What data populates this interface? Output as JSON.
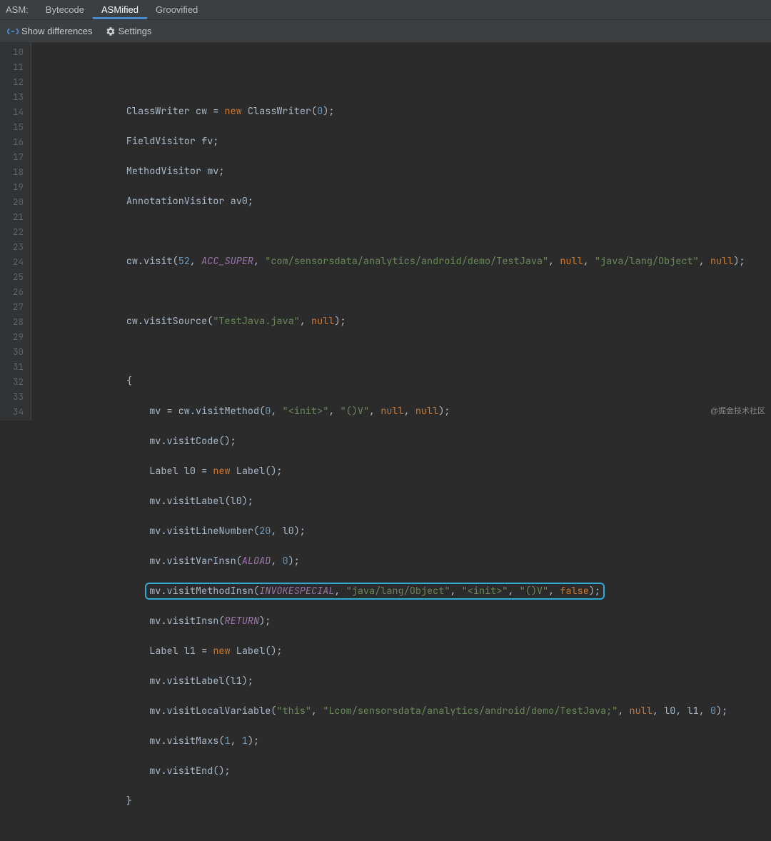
{
  "topbar": {
    "label": "ASM:",
    "tabs": [
      {
        "label": "Bytecode"
      },
      {
        "label": "ASMified"
      },
      {
        "label": "Groovified"
      }
    ],
    "activeTab": "ASMified"
  },
  "toolbar": {
    "show_diff_label": "Show differences",
    "settings_label": "Settings"
  },
  "icons": {
    "diff": "diff-icon",
    "gear": "gear-icon"
  },
  "gutter": {
    "start": 10,
    "end": 34
  },
  "code": {
    "indent1": "        ",
    "indent2": "            ",
    "l10": "",
    "l11": {
      "a": "ClassWriter cw = ",
      "kw": "new",
      "b": " ClassWriter(",
      "n": "0",
      "c": ");"
    },
    "l12": "FieldVisitor fv;",
    "l13": "MethodVisitor mv;",
    "l14": "AnnotationVisitor av0;",
    "l15": "",
    "l16": {
      "a": "cw.visit(",
      "n1": "52",
      "b": ", ",
      "id": "ACC_SUPER",
      "c": ", ",
      "s1": "\"com/sensorsdata/analytics/android/demo/TestJava\"",
      "d": ", ",
      "kw1": "null",
      "e": ", ",
      "s2": "\"java/lang/Object\"",
      "f": ", ",
      "kw2": "null",
      "g": ");"
    },
    "l17": "",
    "l18": {
      "a": "cw.visitSource(",
      "s": "\"TestJava.java\"",
      "b": ", ",
      "kw": "null",
      "c": ");"
    },
    "l19": "",
    "l20": "{",
    "l21": {
      "a": "mv = cw.visitMethod(",
      "n": "0",
      "b": ", ",
      "s1": "\"<init>\"",
      "c": ", ",
      "s2": "\"()V\"",
      "d": ", ",
      "kw1": "null",
      "e": ", ",
      "kw2": "null",
      "f": ");"
    },
    "l22": "mv.visitCode();",
    "l23": {
      "a": "Label l0 = ",
      "kw": "new",
      "b": " Label();"
    },
    "l24": "mv.visitLabel(l0);",
    "l25": {
      "a": "mv.visitLineNumber(",
      "n1": "20",
      "b": ", l0);"
    },
    "l26": {
      "a": "mv.visitVarInsn(",
      "id": "ALOAD",
      "b": ", ",
      "n": "0",
      "c": ");"
    },
    "l27": {
      "a": "mv.visitMethodInsn(",
      "id": "INVOKESPECIAL",
      "b": ", ",
      "s1": "\"java/lang/Object\"",
      "c": ", ",
      "s2": "\"<init>\"",
      "d": ", ",
      "s3": "\"()V\"",
      "e": ", ",
      "kw": "false",
      "f": ");"
    },
    "l28": {
      "a": "mv.visitInsn(",
      "id": "RETURN",
      "b": ");"
    },
    "l29": {
      "a": "Label l1 = ",
      "kw": "new",
      "b": " Label();"
    },
    "l30": "mv.visitLabel(l1);",
    "l31": {
      "a": "mv.visitLocalVariable(",
      "s1": "\"this\"",
      "b": ", ",
      "s2": "\"Lcom/sensorsdata/analytics/android/demo/TestJava;\"",
      "c": ", ",
      "kw": "null",
      "d": ", l0, l1, ",
      "n": "0",
      "e": ");"
    },
    "l32": {
      "a": "mv.visitMaxs(",
      "n1": "1",
      "b": ", ",
      "n2": "1",
      "c": ");"
    },
    "l33": "mv.visitEnd();",
    "l34": "}"
  },
  "highlight": {
    "line": 27
  },
  "watermark": "@掘金技术社区"
}
